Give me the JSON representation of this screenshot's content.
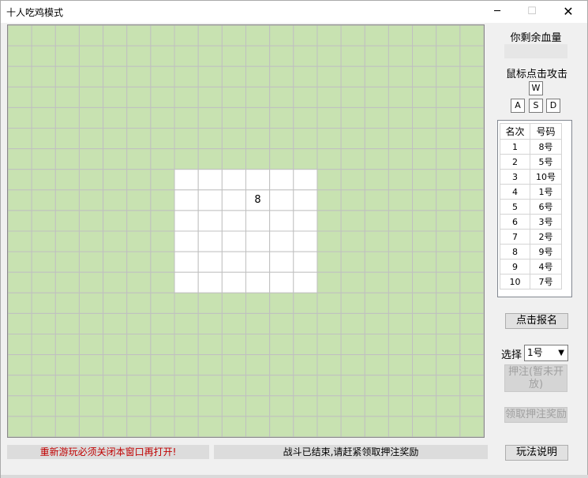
{
  "window": {
    "title": "十人吃鸡模式",
    "minimize": "─",
    "maximize": "☐",
    "close": "✕"
  },
  "board": {
    "columns": 20,
    "rows": 20,
    "safe_zone_cols": [
      7,
      12
    ],
    "safe_zone_rows": [
      7,
      12
    ],
    "player_marker": "8",
    "zone_color": "#c8e2b1",
    "grid_color": "#c0c0c0"
  },
  "panel": {
    "hp_title": "你剩余血量",
    "attack_hint": "鼠标点击攻击",
    "keys": {
      "up": "W",
      "left": "A",
      "down": "S",
      "right": "D"
    },
    "rank_header": [
      "名次",
      "号码"
    ],
    "ranks": [
      [
        "1",
        "8号"
      ],
      [
        "2",
        "5号"
      ],
      [
        "3",
        "10号"
      ],
      [
        "4",
        "1号"
      ],
      [
        "5",
        "6号"
      ],
      [
        "6",
        "3号"
      ],
      [
        "7",
        "2号"
      ],
      [
        "8",
        "9号"
      ],
      [
        "9",
        "4号"
      ],
      [
        "10",
        "7号"
      ]
    ],
    "signup_button": "点击报名",
    "select_label": "选择",
    "select_value": "1号",
    "bet_button_line1": "押注(暂未开",
    "bet_button_line2": "放)",
    "claim_button": "领取押注奖励",
    "rules_button": "玩法说明"
  },
  "status": {
    "warning": "重新游玩必须关闭本窗口再打开!",
    "info": "战斗已结束,请赶紧领取押注奖励"
  }
}
